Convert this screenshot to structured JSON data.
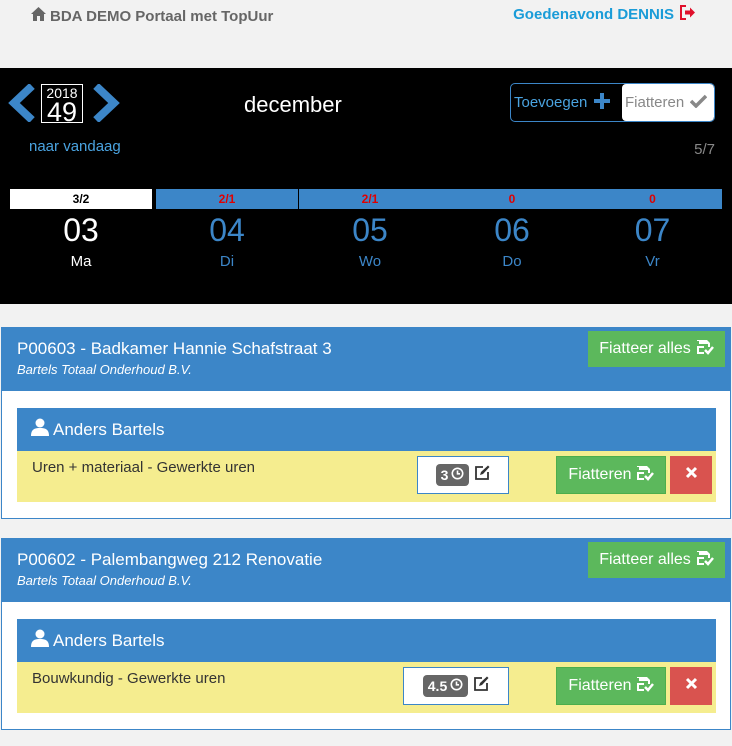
{
  "header": {
    "brand": "BDA DEMO Portaal met TopUur",
    "greeting": "Goedenavond DENNIS"
  },
  "calendar": {
    "year": "2018",
    "week": "49",
    "month": "december",
    "today_link": "naar vandaag",
    "add_label": "Toevoegen",
    "approve_label": "Fiatteren",
    "counter": "5/7",
    "days": [
      {
        "count": "3/2",
        "date": "03",
        "name": "Ma",
        "active": true
      },
      {
        "count": "2/1",
        "date": "04",
        "name": "Di",
        "active": false
      },
      {
        "count": "2/1",
        "date": "05",
        "name": "Wo",
        "active": false
      },
      {
        "count": "0",
        "date": "06",
        "name": "Do",
        "active": false
      },
      {
        "count": "0",
        "date": "07",
        "name": "Vr",
        "active": false
      }
    ]
  },
  "projects": [
    {
      "title": "P00603 - Badkamer Hannie Schafstraat 3",
      "company": "Bartels Totaal Onderhoud B.V.",
      "approve_all": "Fiatteer alles",
      "employee": "Anders Bartels",
      "entry": {
        "description": "Uren + materiaal - Gewerkte uren",
        "hours": "3",
        "approve": "Fiatteren"
      }
    },
    {
      "title": "P00602 - Palembangweg 212 Renovatie",
      "company": "Bartels Totaal Onderhoud B.V.",
      "approve_all": "Fiatteer alles",
      "employee": "Anders Bartels",
      "entry": {
        "description": "Bouwkundig - Gewerkte uren",
        "hours": "4.5",
        "approve": "Fiatteren"
      }
    }
  ],
  "colors": {
    "primary": "#3c86c8",
    "success": "#5cb85c",
    "danger": "#d9534f",
    "highlight": "#f5ed8f",
    "link": "#1a9cd8"
  }
}
